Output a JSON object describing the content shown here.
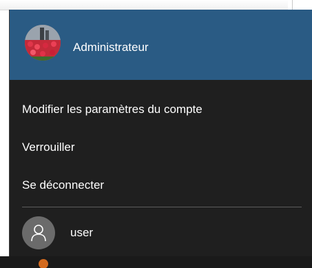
{
  "header": {
    "account_name": "Administrateur",
    "avatar_icon": "flower-photo-avatar",
    "background_color": "#2a5b84"
  },
  "menu": {
    "items": [
      {
        "label": "Modifier les paramètres du compte"
      },
      {
        "label": "Verrouiller"
      },
      {
        "label": "Se déconnecter"
      }
    ]
  },
  "other_user": {
    "name": "user",
    "avatar_icon": "person-icon"
  },
  "colors": {
    "menu_background": "#1f1f1f",
    "text": "#ffffff",
    "divider": "#5d5d5d"
  }
}
